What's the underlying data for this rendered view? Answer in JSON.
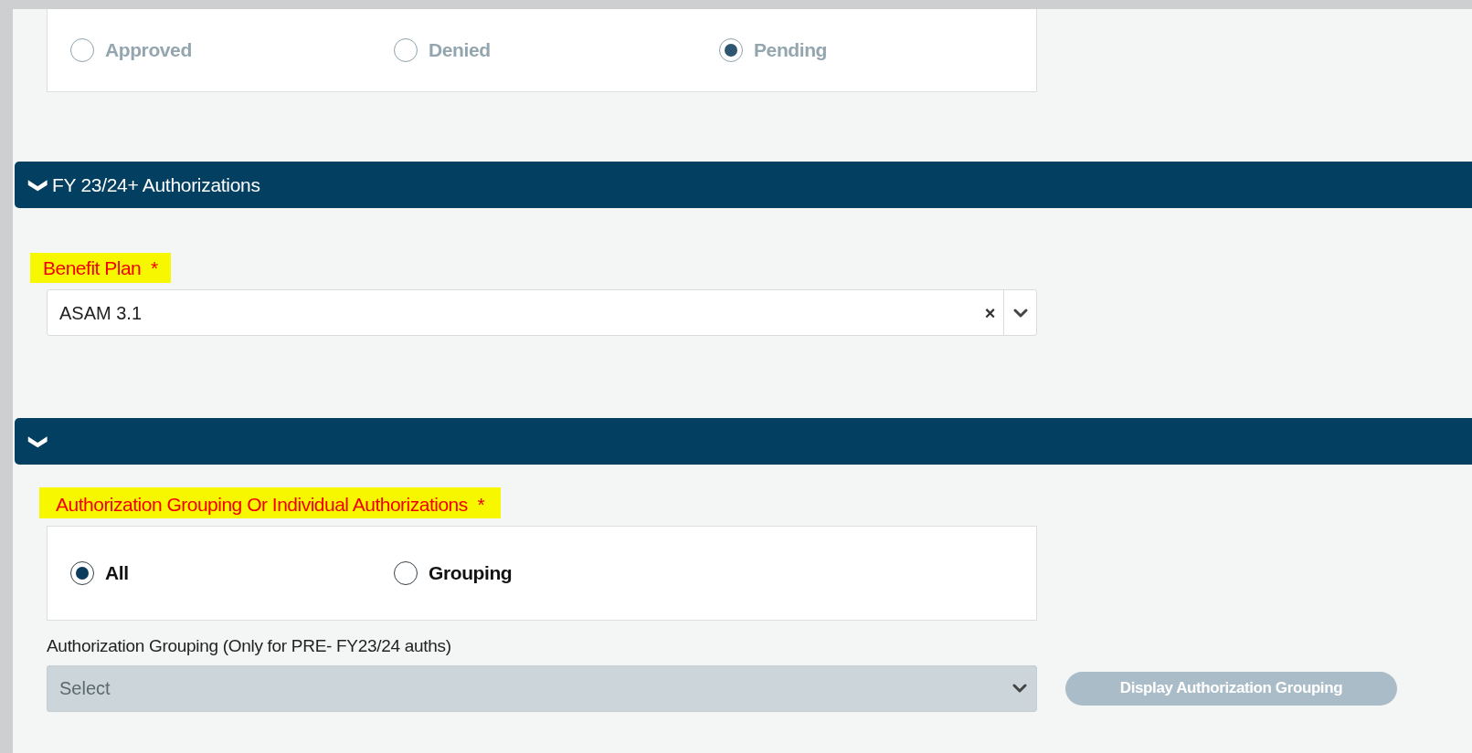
{
  "status_group": {
    "disabled": true,
    "options": [
      {
        "label": "Approved",
        "selected": false
      },
      {
        "label": "Denied",
        "selected": false
      },
      {
        "label": "Pending",
        "selected": true
      }
    ]
  },
  "sections": [
    {
      "title": "FY 23/24+ Authorizations",
      "expanded": true,
      "toggle": "❯"
    },
    {
      "expanded": true,
      "toggle": "❯"
    }
  ],
  "benefit_plan": {
    "label": "Benefit Plan",
    "required": "*",
    "highlighted": true,
    "value": "ASAM 3.1",
    "clear": "×"
  },
  "authorization_type": {
    "label": "Authorization Grouping Or Individual Authorizations",
    "required": "*",
    "highlighted": true,
    "disabled": false,
    "options": [
      {
        "label": "All",
        "selected": true
      },
      {
        "label": "Grouping",
        "selected": false
      }
    ]
  },
  "authorization_grouping": {
    "label": "Authorization Grouping (Only for PRE- FY23/24 auths)",
    "placeholder": "Select",
    "disabled": true
  },
  "display_button": {
    "label": "Display Authorization Grouping",
    "disabled": true
  }
}
